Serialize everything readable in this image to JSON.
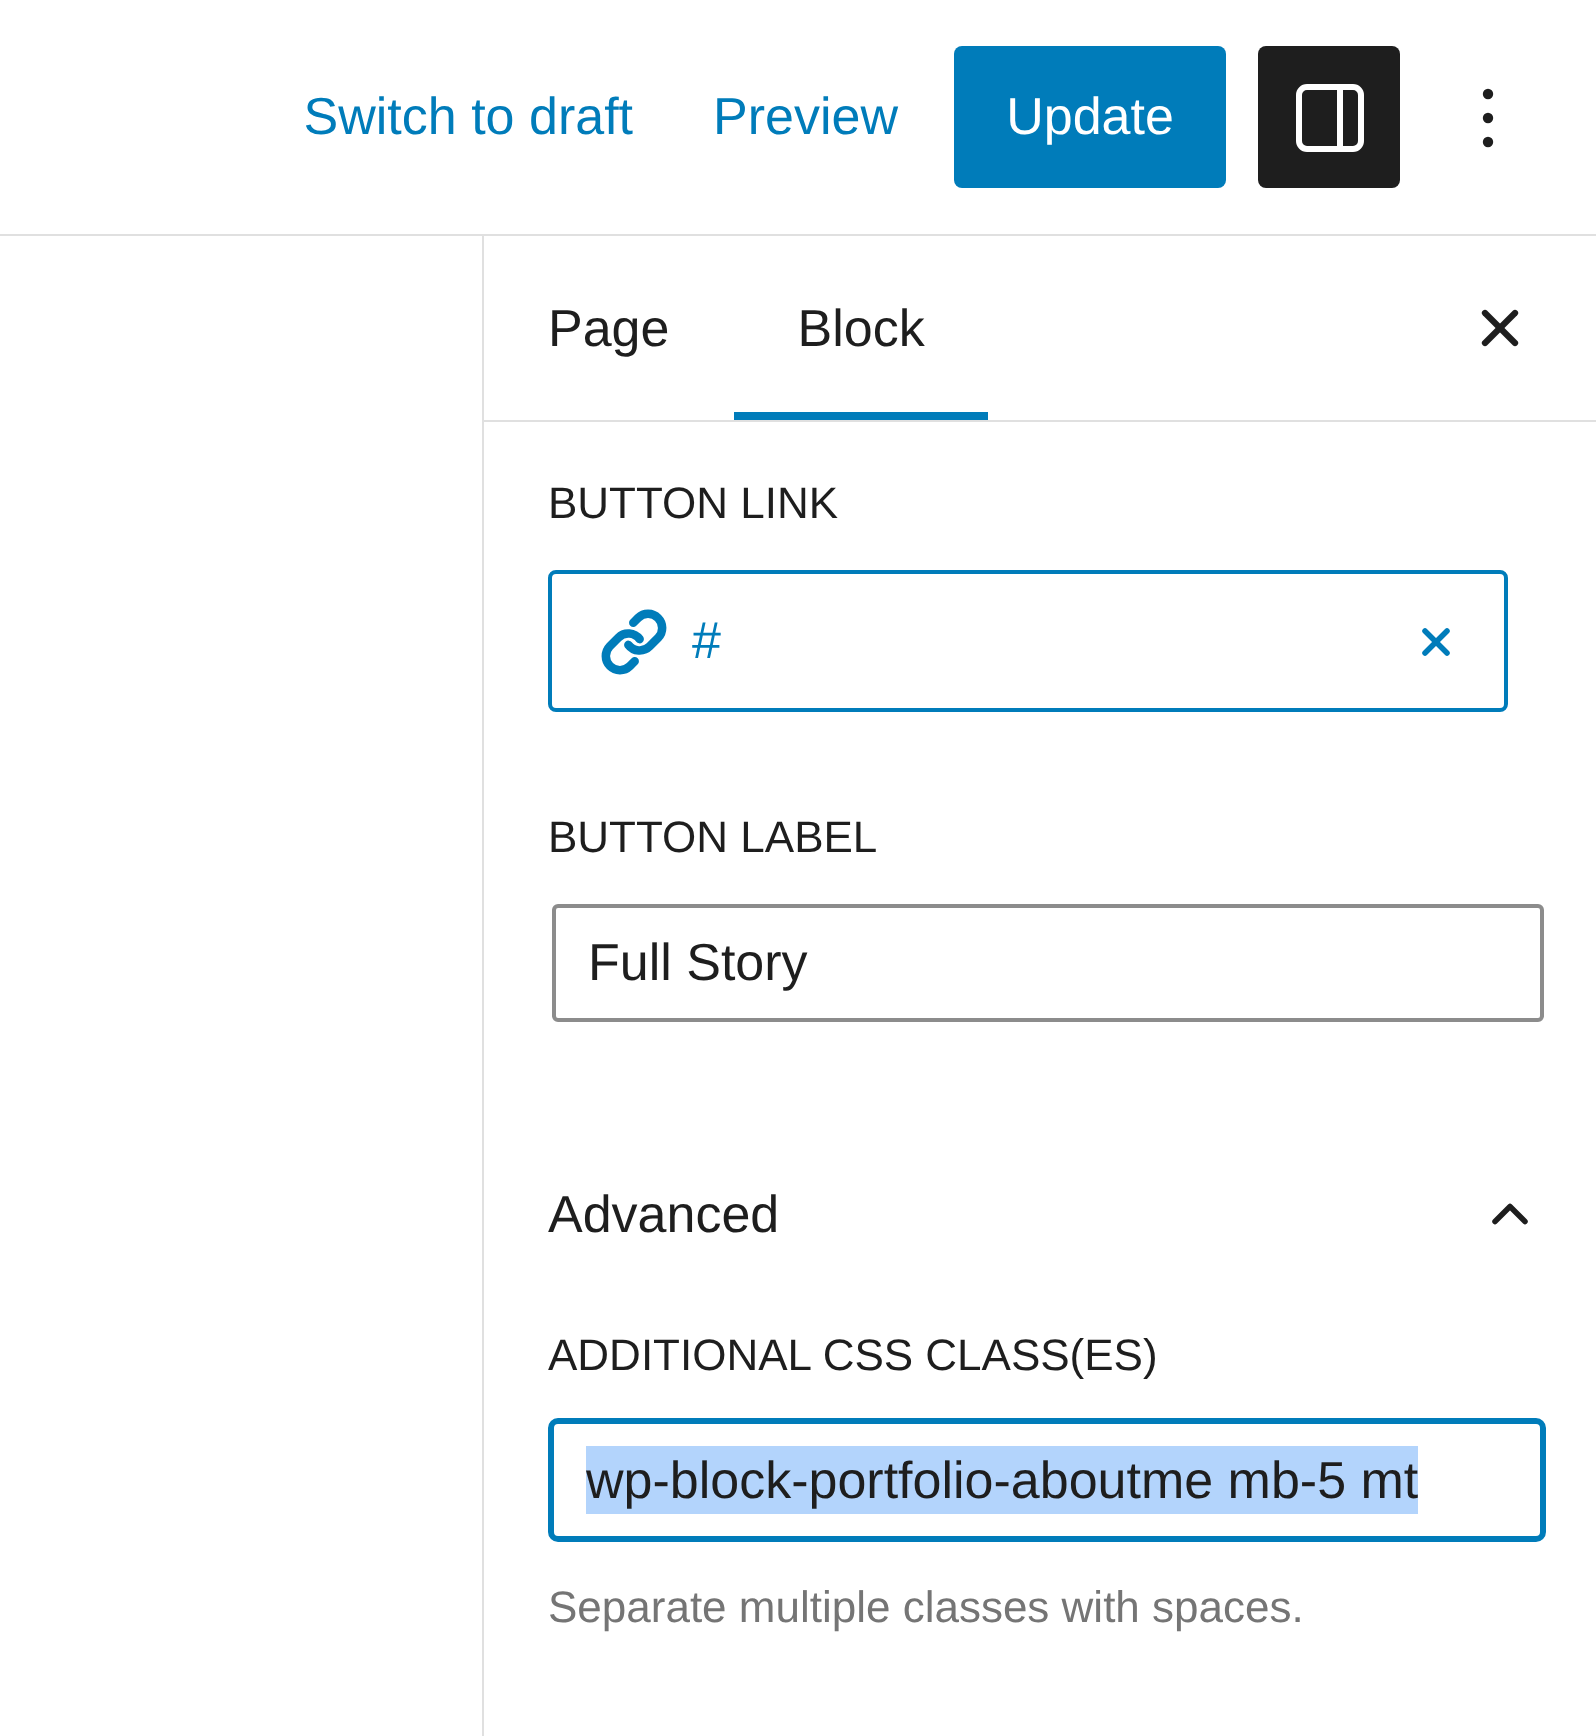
{
  "header": {
    "actions": [
      {
        "kind": "link",
        "label": "Switch to draft"
      },
      {
        "kind": "link",
        "label": "Preview"
      },
      {
        "kind": "primary",
        "label": "Update"
      }
    ],
    "sidebar_toggle": {
      "pressed": true
    }
  },
  "sidebar": {
    "tabs": [
      {
        "label": "Page",
        "selected": false
      },
      {
        "label": "Block",
        "selected": true
      }
    ],
    "fields": [
      {
        "kind": "link",
        "label": "BUTTON LINK",
        "value": "#"
      },
      {
        "kind": "text",
        "label": "BUTTON LABEL",
        "value": "Full Story"
      }
    ],
    "advanced": {
      "title": "Advanced",
      "expanded": true,
      "field": {
        "label": "ADDITIONAL CSS CLASS(ES)",
        "value": "wp-block-portfolio-aboutme mb-5 mt",
        "focused": true,
        "text_selected": true,
        "help": "Separate multiple classes with spaces."
      }
    }
  }
}
